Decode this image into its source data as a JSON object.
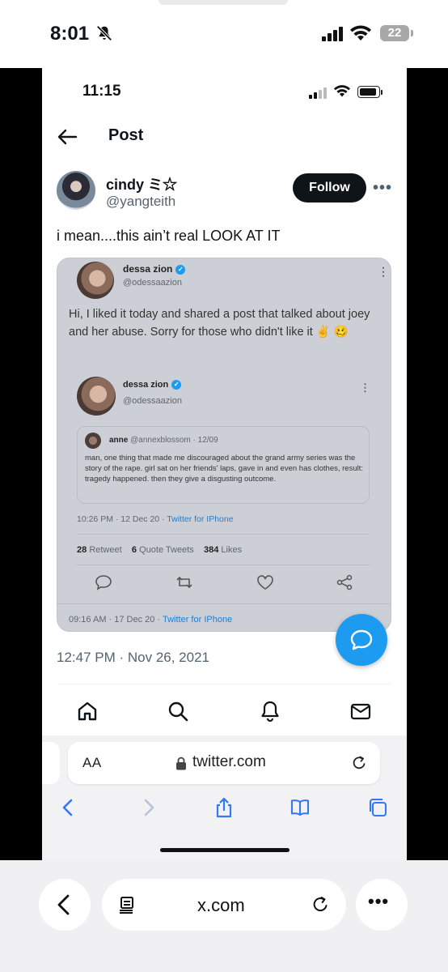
{
  "outer_status": {
    "time": "8:01",
    "battery": "22"
  },
  "inner_status": {
    "time": "11:15"
  },
  "header": {
    "title": "Post"
  },
  "author": {
    "name": "cindy ミ☆",
    "handle": "@yangteith",
    "follow_label": "Follow"
  },
  "tweet": {
    "text": "i mean....this ain’t real LOOK AT IT",
    "timestamp": "12:47 PM · Nov 26, 2021"
  },
  "media": {
    "post1": {
      "name": "dessa zion",
      "handle": "@odessaazion",
      "text": "Hi, I liked it today and shared a post that talked about joey and her abuse. Sorry for those who didn't like it ✌️ 🥴",
      "meta_time": "09:16 AM · 17 Dec 20 · ",
      "meta_source": "Twitter for IPhone"
    },
    "post2": {
      "name": "dessa zion",
      "handle": "@odessaazion",
      "meta_time": "10:26 PM · 12 Dec 20 · ",
      "meta_source": "Twitter for IPhone",
      "retweets": "28",
      "retweets_label": "Retweet",
      "quotes": "6",
      "quotes_label": "Quote Tweets",
      "likes": "384",
      "likes_label": "Likes"
    },
    "quote": {
      "name": "anne",
      "handle_date": "@annexblossom · 12/09",
      "text": "man, one thing that made me discouraged about the grand army series was the story of the rape. girl sat on her friends' laps, gave in and even has clothes, result: tragedy happened. then they give a disgusting outcome."
    }
  },
  "safari": {
    "aa": "AA",
    "domain": "twitter.com"
  },
  "outer_bottom": {
    "domain": "x.com"
  },
  "colors": {
    "accent": "#1d9bf0",
    "text": "#0f1419",
    "muted": "#536471",
    "safari_blue": "#3478f6"
  }
}
